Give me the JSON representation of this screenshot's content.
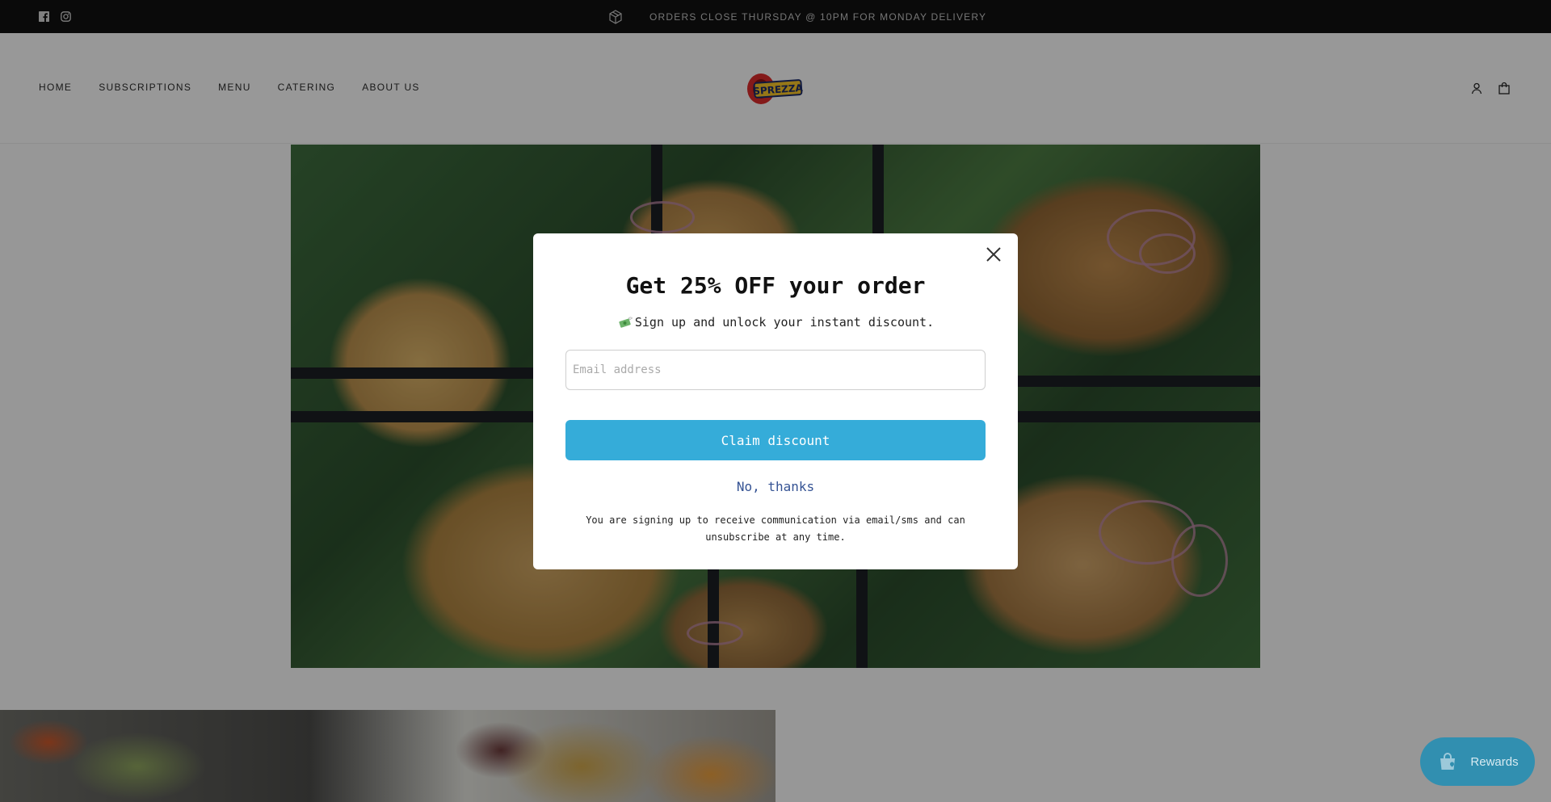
{
  "announcement": {
    "message": "ORDERS CLOSE THURSDAY @ 10PM FOR MONDAY DELIVERY",
    "social_icons": [
      "facebook-icon",
      "instagram-icon"
    ],
    "message_icon": "box-icon"
  },
  "header": {
    "nav": [
      "HOME",
      "SUBSCRIPTIONS",
      "MENU",
      "CATERING",
      "ABOUT US"
    ],
    "logo_text": "SPREZZA",
    "icons": [
      "account-icon",
      "cart-icon"
    ]
  },
  "modal": {
    "title": "Get 25% OFF your order",
    "subtitle": "Sign up and unlock your instant discount.",
    "subtitle_icon": "money-with-wings-icon",
    "email_placeholder": "Email address",
    "claim_label": "Claim discount",
    "decline_label": "No, thanks",
    "legal": "You are signing up to receive communication via email/sms and can unsubscribe at any time."
  },
  "rewards": {
    "label": "Rewards",
    "icon": "gift-bag-icon"
  },
  "colors": {
    "announcement_bg": "#111111",
    "claim_button": "#35acd9",
    "decline_link": "#355394",
    "rewards_bg": "#318fb0"
  }
}
